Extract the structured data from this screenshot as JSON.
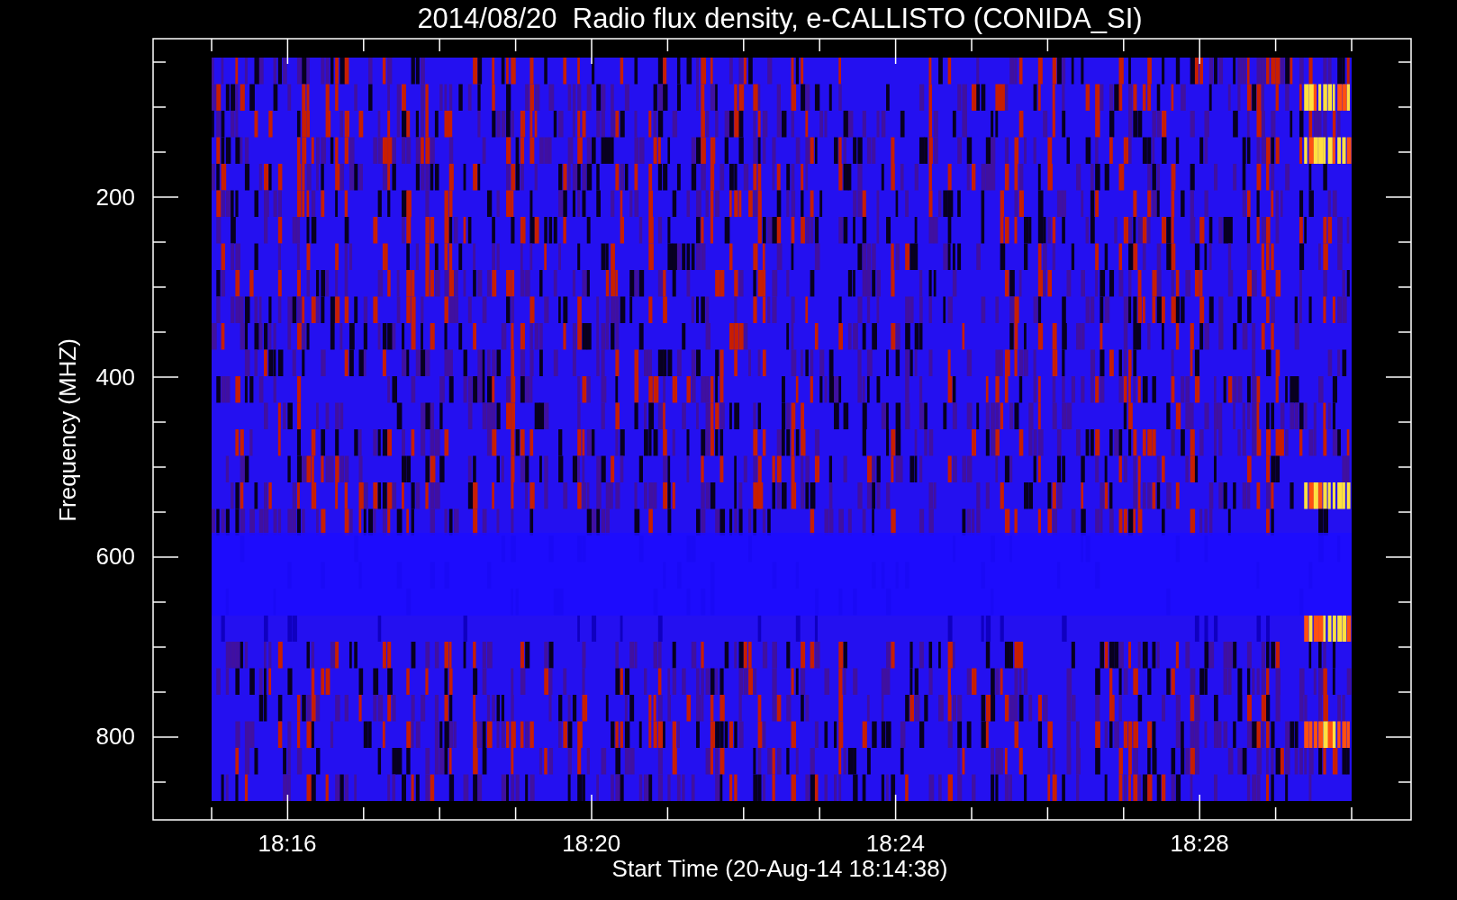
{
  "title": "2014/08/20  Radio flux density, e-CALLISTO (CONIDA_SI)",
  "y_axis": {
    "label": "Frequency (MHZ)",
    "ticks": [
      "200",
      "400",
      "600",
      "800"
    ]
  },
  "x_axis": {
    "label": "Start Time (20-Aug-14 18:14:38)",
    "ticks": [
      "18:16",
      "18:20",
      "18:24",
      "18:28"
    ]
  }
}
